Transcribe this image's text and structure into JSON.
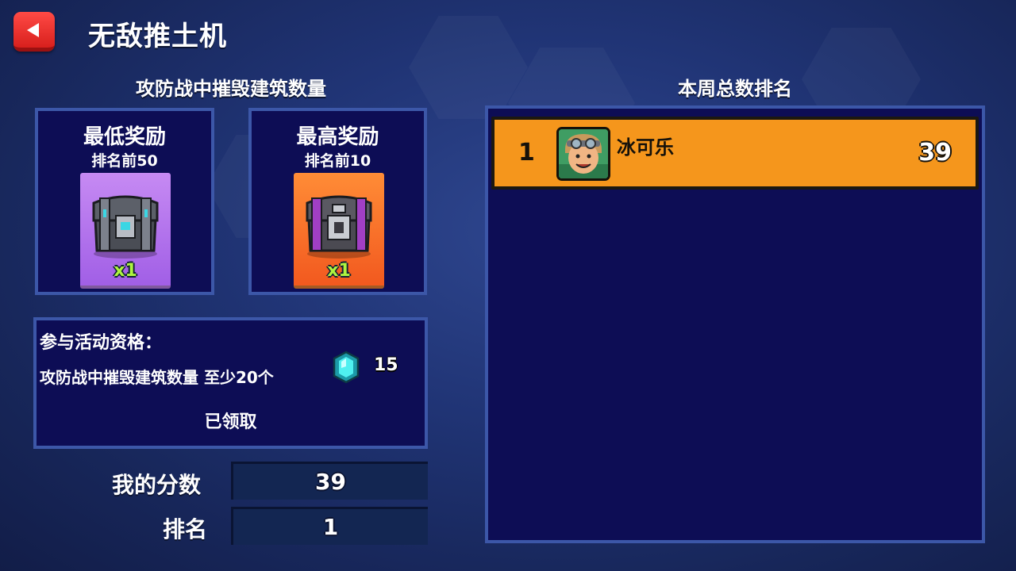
{
  "header": {
    "title": "无敌推土机",
    "back_icon": "back-arrow-icon"
  },
  "rewards": {
    "section_title": "攻防战中摧毁建筑数量",
    "items": [
      {
        "name": "最低奖励",
        "rank_text": "排名前50",
        "quantity": "x1",
        "card_color": "#a966ea",
        "icon": "chest-icon"
      },
      {
        "name": "最高奖励",
        "rank_text": "排名前10",
        "quantity": "x1",
        "card_color": "#f7692a",
        "icon": "chest-icon"
      }
    ]
  },
  "eligibility": {
    "title": "参与活动资格：",
    "requirement": "攻防战中摧毁建筑数量 至少20个",
    "gem_amount": "15",
    "gem_icon": "gem-icon",
    "status": "已领取"
  },
  "stats": {
    "score_label": "我的分数",
    "score_value": "39",
    "rank_label": "排名",
    "rank_value": "1"
  },
  "leaderboard": {
    "title": "本周总数排名",
    "highlight_color": "#f5961c",
    "rows": [
      {
        "rank": "1",
        "name": "冰可乐",
        "score": "39",
        "avatar": "player-avatar-icon"
      }
    ]
  }
}
